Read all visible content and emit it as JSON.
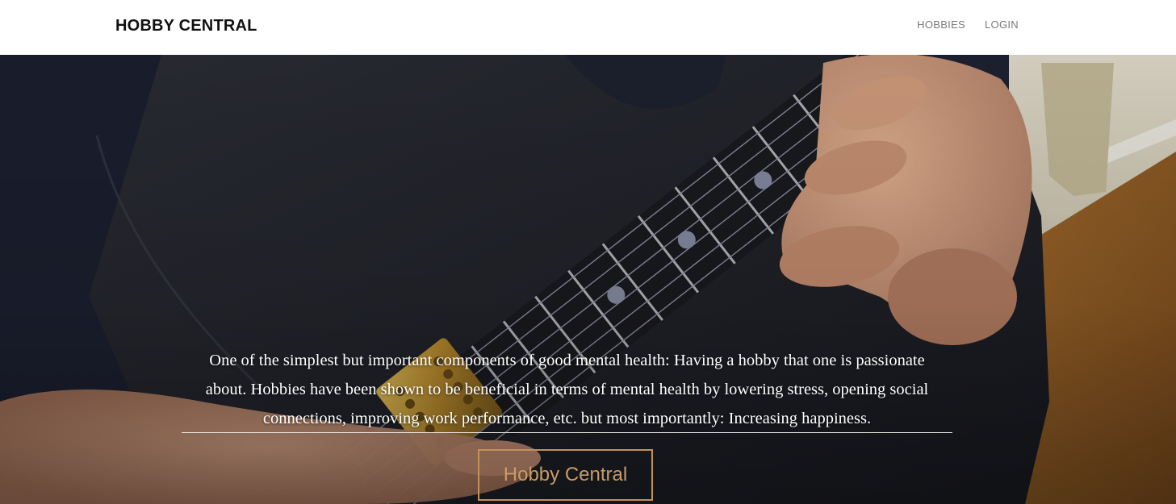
{
  "header": {
    "brand": "HOBBY CENTRAL",
    "nav": [
      {
        "label": "HOBBIES"
      },
      {
        "label": "LOGIN"
      }
    ]
  },
  "hero": {
    "background_image": "guitar-closeup-photo",
    "tagline": "One of the simplest but important components of good mental health: Having a hobby that one is passionate about. Hobbies have been shown to be beneficial in terms of mental health by lowering stress, opening social connections, improving work performance, etc. but most importantly: Increasing happiness.",
    "cta_label": "Hobby Central"
  },
  "colors": {
    "accent": "#c3915a",
    "brand_text": "#111111",
    "nav_text": "#7a7a7a",
    "hero_text": "#ffffff"
  }
}
